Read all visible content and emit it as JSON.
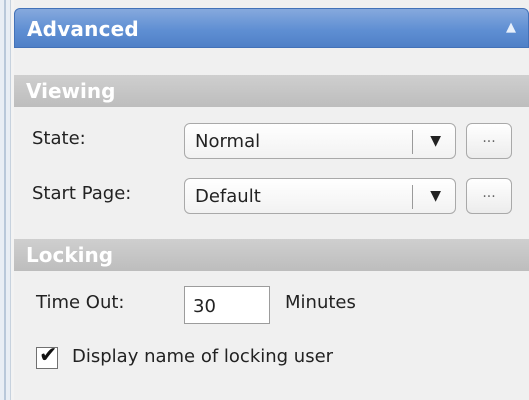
{
  "advanced": {
    "title": "Advanced",
    "collapse_icon": "triangle-up-icon"
  },
  "viewing": {
    "section_title": "Viewing",
    "state": {
      "label": "State:",
      "value": "Normal",
      "arrow": "▼",
      "browse": "..."
    },
    "start_page": {
      "label": "Start Page:",
      "value": "Default",
      "arrow": "▼",
      "browse": "..."
    }
  },
  "locking": {
    "section_title": "Locking",
    "timeout": {
      "label": "Time Out:",
      "value": "30",
      "unit": "Minutes"
    },
    "display_name": {
      "label": "Display name of locking user",
      "checked": true
    }
  }
}
